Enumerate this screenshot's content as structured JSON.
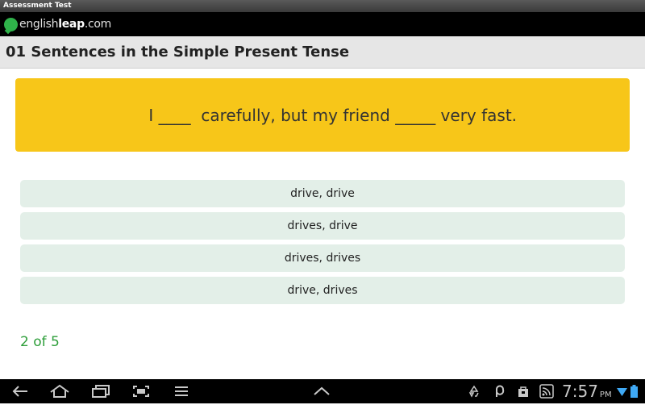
{
  "window": {
    "title": "Assessment Test"
  },
  "brand": {
    "part1": "english",
    "part2": "leap",
    "part3": ".com"
  },
  "header": {
    "title": "01 Sentences in the Simple Present Tense"
  },
  "question": {
    "seg1": "I ",
    "blank1": "____",
    "seg2": "  carefully, but my friend ",
    "blank2": "_____",
    "seg3": " very fast."
  },
  "options": [
    {
      "label": "drive, drive"
    },
    {
      "label": "drives, drive"
    },
    {
      "label": "drives, drives"
    },
    {
      "label": "drive, drives"
    }
  ],
  "progress": {
    "text": "2 of 5"
  },
  "status": {
    "time": "7:57",
    "ampm": "PM"
  },
  "icons": {
    "back": "back-arrow-icon",
    "home": "home-icon",
    "recent": "recent-apps-icon",
    "screenshot": "screenshot-icon",
    "menu": "menu-icon",
    "up": "chevron-up-icon",
    "recycle": "recycle-icon",
    "p": "p-icon",
    "bag": "bag-icon",
    "feed": "feed-icon",
    "wifi": "wifi-icon",
    "battery": "battery-icon"
  },
  "colors": {
    "question_bg": "#f7c619",
    "option_bg": "#e3efe8",
    "progress_text": "#2e9e3a",
    "brand_green": "#2fb24a"
  }
}
